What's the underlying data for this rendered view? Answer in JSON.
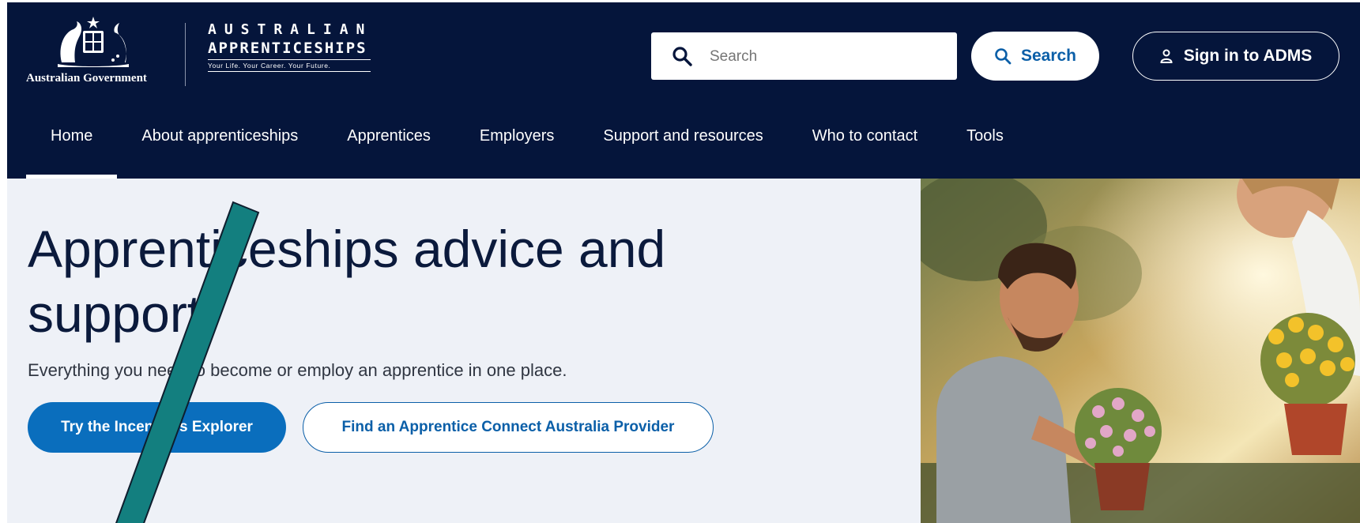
{
  "header": {
    "gov_name": "Australian Government",
    "program_logo": {
      "line1": "AUSTRALIAN",
      "line2": "APPRENTICESHIPS",
      "tagline": "Your Life. Your Career. Your Future."
    },
    "search": {
      "placeholder": "Search",
      "button_label": "Search",
      "icon": "search-icon"
    },
    "sign_in": {
      "label": "Sign in to ADMS",
      "icon": "user-icon"
    }
  },
  "nav": {
    "items": [
      {
        "label": "Home",
        "active": true
      },
      {
        "label": "About apprenticeships"
      },
      {
        "label": "Apprentices"
      },
      {
        "label": "Employers"
      },
      {
        "label": "Support and resources"
      },
      {
        "label": "Who to contact"
      },
      {
        "label": "Tools"
      }
    ]
  },
  "hero": {
    "title": "Apprenticeships advice and support",
    "subtitle": "Everything you need to become or employ an apprentice in one place.",
    "primary_button": "Try the Incentives Explorer",
    "secondary_button": "Find an Apprentice Connect Australia Provider",
    "image": "gardeners-with-flower-pots-photo"
  },
  "colors": {
    "header_bg": "#05153b",
    "hero_bg": "#eef1f7",
    "primary": "#0a6ebd",
    "link": "#0b5fa8",
    "annotation": "#137f7f"
  }
}
